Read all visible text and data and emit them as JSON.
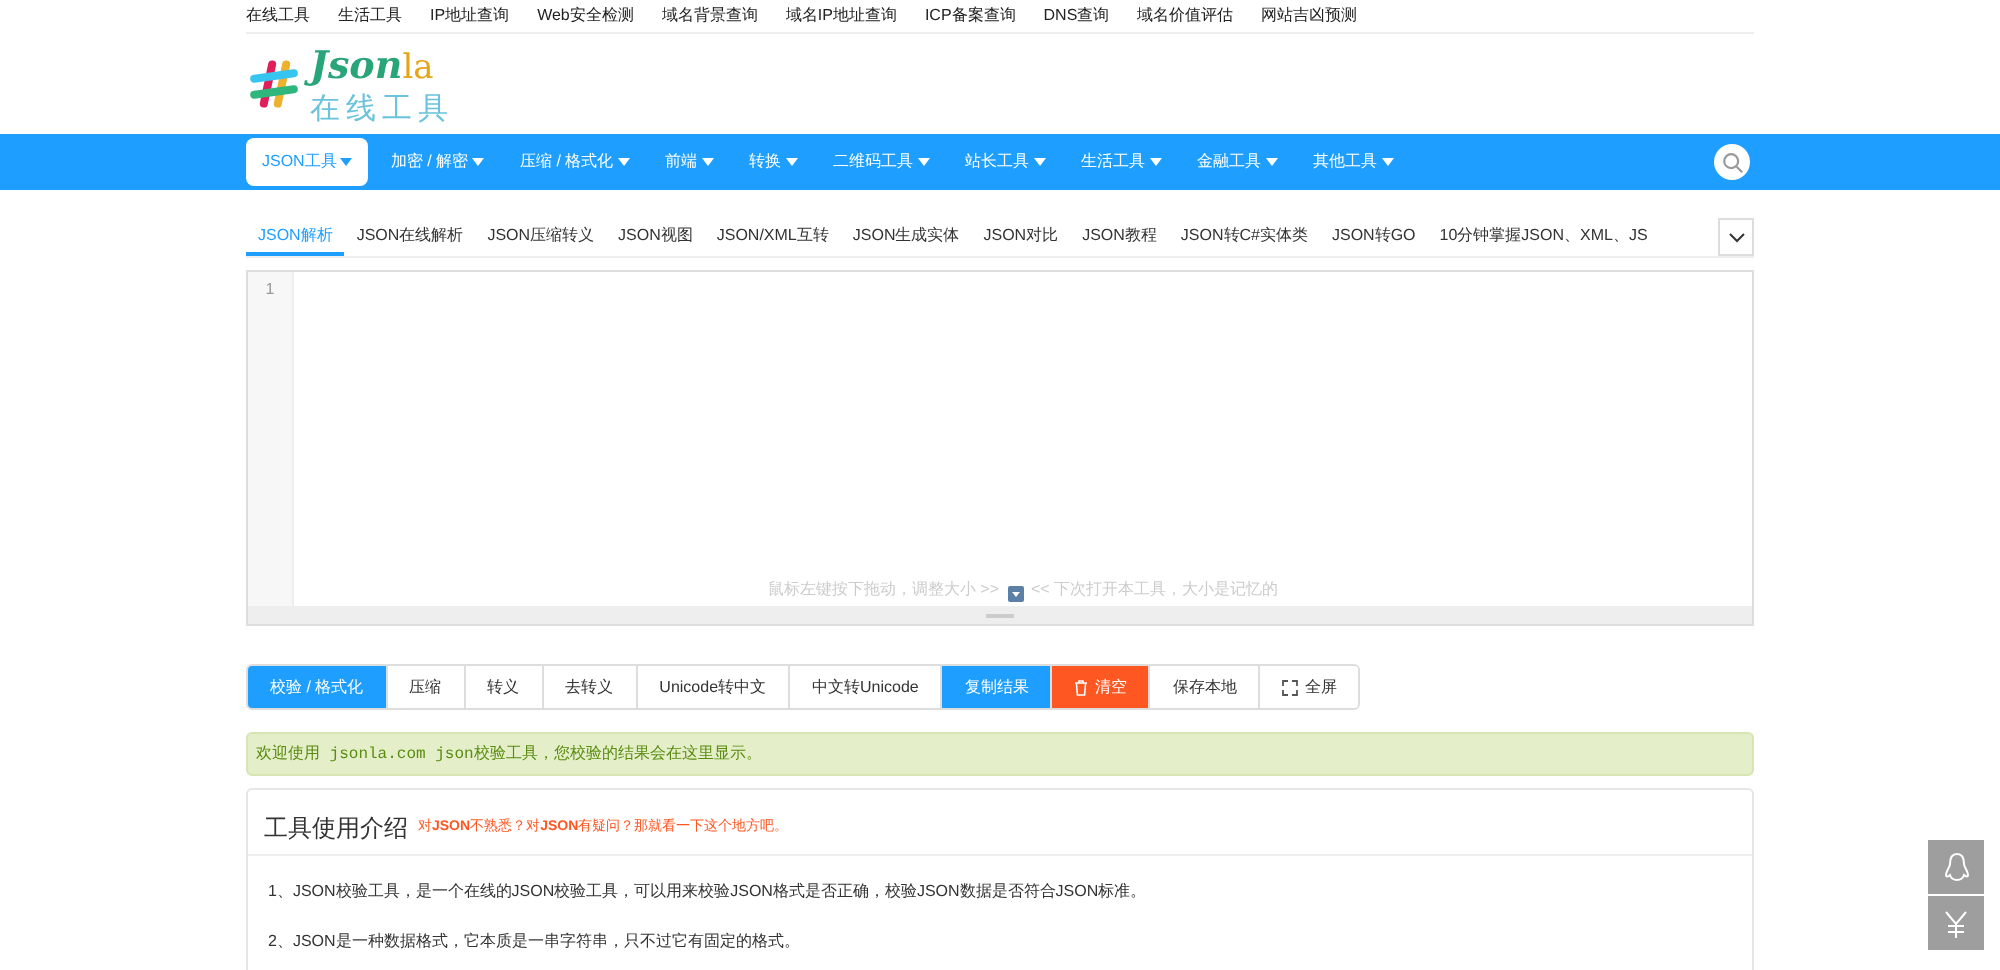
{
  "top_links": [
    "在线工具",
    "生活工具",
    "IP地址查询",
    "Web安全检测",
    "域名背景查询",
    "域名IP地址查询",
    "ICP备案查询",
    "DNS查询",
    "域名价值评估",
    "网站吉凶预测"
  ],
  "logo": {
    "name_main": "Json",
    "name_suffix": "la",
    "subtitle": "在线工具"
  },
  "nav": [
    {
      "label": "JSON工具",
      "selected": true
    },
    {
      "label": "加密 / 解密",
      "selected": false
    },
    {
      "label": "压缩 / 格式化",
      "selected": false
    },
    {
      "label": "前端",
      "selected": false
    },
    {
      "label": "转换",
      "selected": false
    },
    {
      "label": "二维码工具",
      "selected": false
    },
    {
      "label": "站长工具",
      "selected": false
    },
    {
      "label": "生活工具",
      "selected": false
    },
    {
      "label": "金融工具",
      "selected": false
    },
    {
      "label": "其他工具",
      "selected": false
    }
  ],
  "tabs": [
    {
      "label": "JSON解析",
      "selected": true
    },
    {
      "label": "JSON在线解析",
      "selected": false
    },
    {
      "label": "JSON压缩转义",
      "selected": false
    },
    {
      "label": "JSON视图",
      "selected": false
    },
    {
      "label": "JSON/XML互转",
      "selected": false
    },
    {
      "label": "JSON生成实体",
      "selected": false
    },
    {
      "label": "JSON对比",
      "selected": false
    },
    {
      "label": "JSON教程",
      "selected": false
    },
    {
      "label": "JSON转C#实体类",
      "selected": false
    },
    {
      "label": "JSON转GO",
      "selected": false
    },
    {
      "label": "10分钟掌握JSON、XML、JS",
      "selected": false
    }
  ],
  "editor": {
    "line_numbers": [
      "1"
    ],
    "hint_before": "鼠标左键按下拖动，调整大小 >>",
    "hint_after": "<< 下次打开本工具，大小是记忆的"
  },
  "buttons": [
    {
      "label": "校验 / 格式化",
      "kind": "active"
    },
    {
      "label": "压缩",
      "kind": "plain"
    },
    {
      "label": "转义",
      "kind": "plain"
    },
    {
      "label": "去转义",
      "kind": "plain"
    },
    {
      "label": "Unicode转中文",
      "kind": "plain"
    },
    {
      "label": "中文转Unicode",
      "kind": "plain"
    },
    {
      "label": "复制结果",
      "kind": "active"
    },
    {
      "label": "清空",
      "kind": "danger"
    },
    {
      "label": "保存本地",
      "kind": "plain"
    },
    {
      "label": "全屏",
      "kind": "fullscreen"
    }
  ],
  "result_message": "欢迎使用 jsonla.com json校验工具，您校验的结果会在这里显示。",
  "intro": {
    "title": "工具使用介绍",
    "subtitle": "对**JSON**不熟悉？对**JSON**有疑问？那就看一下这个地方吧。",
    "paragraphs": [
      "1、JSON校验工具，是一个在线的JSON校验工具，可以用来校验JSON格式是否正确，校验JSON数据是否符合JSON标准。",
      "2、JSON是一种数据格式，它本质是一串字符串，只不过它有固定的格式。"
    ]
  }
}
